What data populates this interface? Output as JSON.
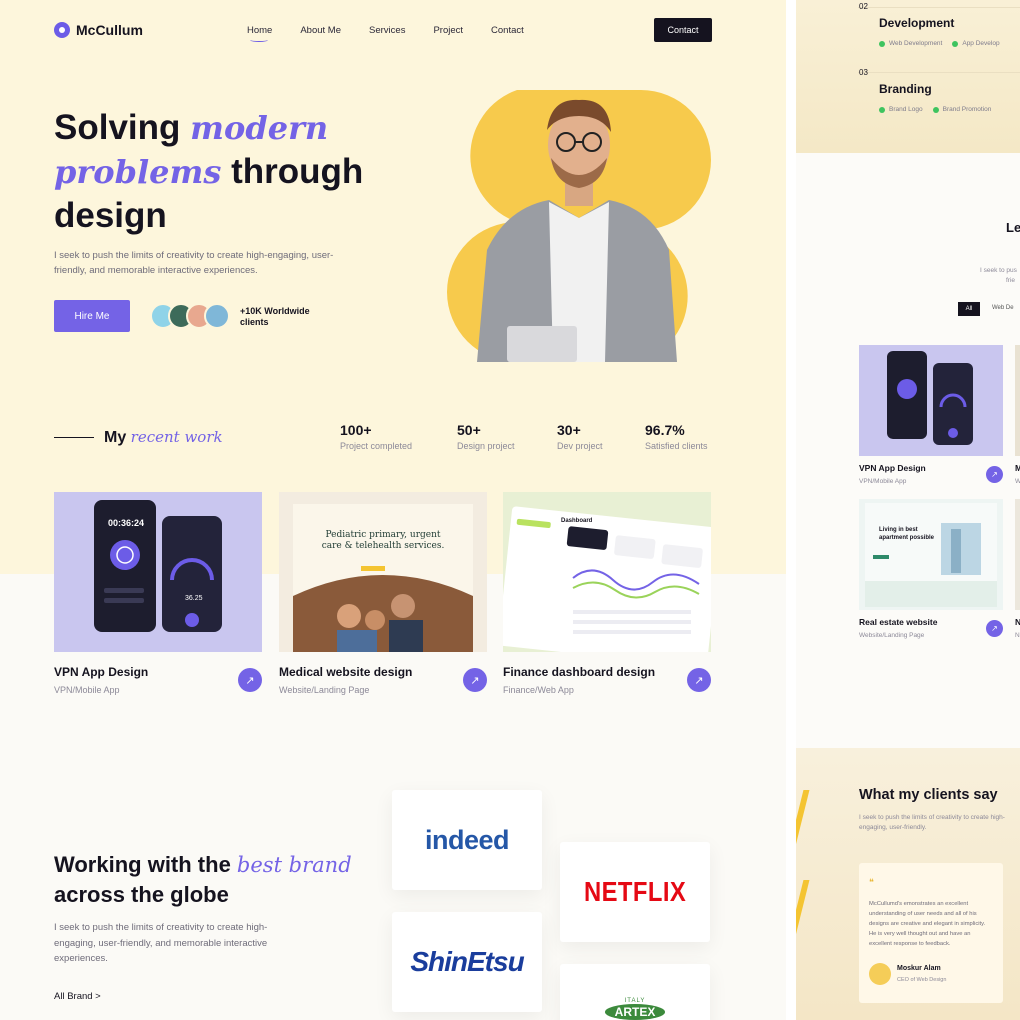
{
  "nav": {
    "logo": "McCullum",
    "links": [
      "Home",
      "About Me",
      "Services",
      "Project",
      "Contact"
    ],
    "cta": "Contact"
  },
  "hero": {
    "title_1": "Solving ",
    "title_2_italic": "modern problems",
    "title_3": " through design",
    "subtitle": "I seek to push the limits of creativity to create high-engaging, user-friendly, and memorable interactive experiences.",
    "hire_button": "Hire Me",
    "clients_note": "+10K Worldwide clients"
  },
  "recent": {
    "title": "My ",
    "title_italic": "recent work"
  },
  "stats": [
    {
      "value": "100+",
      "label": "Project completed"
    },
    {
      "value": "50+",
      "label": "Design project"
    },
    {
      "value": "30+",
      "label": "Dev project"
    },
    {
      "value": "96.7%",
      "label": "Satisfied clients"
    }
  ],
  "works": [
    {
      "title": "VPN App Design",
      "subtitle": "VPN/Mobile App",
      "timer": "00:36:24",
      "speed": "36.25"
    },
    {
      "title": "Medical website design",
      "subtitle": "Website/Landing Page",
      "headline": "Pediatric primary, urgent care & telehealth services."
    },
    {
      "title": "Finance dashboard design",
      "subtitle": "Finance/Web App",
      "dashboard_label": "Dashboard"
    }
  ],
  "brands": {
    "title_1": "Working with the ",
    "title_italic": "best brand",
    "title_2": " across the globe",
    "subtitle": "I seek to push the limits of creativity to create high-engaging, user-friendly, and memorable interactive experiences.",
    "all_link": "All Brand >",
    "logos": [
      "indeed",
      "NETFLIX",
      "ShinEtsu",
      "ARTEX",
      "ITALY"
    ]
  },
  "right": {
    "services": [
      {
        "num": "02",
        "title": "Development",
        "tags": [
          "Web Development",
          "App Develop"
        ]
      },
      {
        "num": "03",
        "title": "Branding",
        "tags": [
          "Brand Logo",
          "Brand Promotion"
        ]
      }
    ],
    "section_fragment": "Le",
    "section_sub": "I seek to pus",
    "section_sub2": "frie",
    "filter_all": "All",
    "filter_web": "Web De",
    "cards": [
      {
        "title": "VPN App Design",
        "subtitle": "VPN/Mobile App",
        "title_frag": "M",
        "sub_frag": "W"
      },
      {
        "title": "Real estate website",
        "subtitle": "Website/Landing Page",
        "title_frag": "N",
        "sub_frag": "N",
        "headline": "Living in best apartment possible"
      }
    ],
    "testimonials_title": "What my clients say",
    "testimonials_sub": "I seek to push the limits of creativity to create high-engaging, user-friendly.",
    "quote": "McCullumd's emonstrates an excellent understanding of user needs and all of his designs are creative and elegant in simplicity. He is very well thought out and have an excellent response to feedback.",
    "author_name": "Moskur Alam",
    "author_role": "CEO of Web Design"
  }
}
